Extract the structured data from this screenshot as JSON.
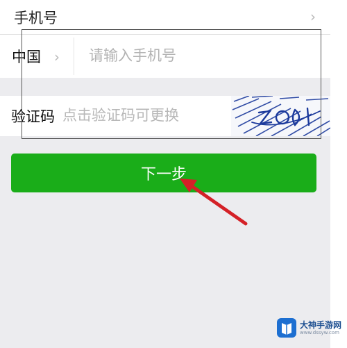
{
  "form": {
    "phone_section_label": "手机号",
    "country_label": "中国",
    "phone_placeholder": "请输入手机号",
    "captcha_label": "验证码",
    "captcha_placeholder": "点击验证码可更换",
    "next_button_label": "下一步"
  },
  "icons": {
    "row_chevron": "chevron-right-icon",
    "country_chevron": "chevron-right-icon",
    "annotation": "red-arrow-icon"
  },
  "watermark": {
    "title": "大神手游网",
    "url": "www.dssyw.com"
  },
  "colors": {
    "primary_button": "#1aad19",
    "annotation_arrow": "#d42127",
    "captcha_ink": "#1c3a9c",
    "watermark_brand": "#1d4f91"
  }
}
